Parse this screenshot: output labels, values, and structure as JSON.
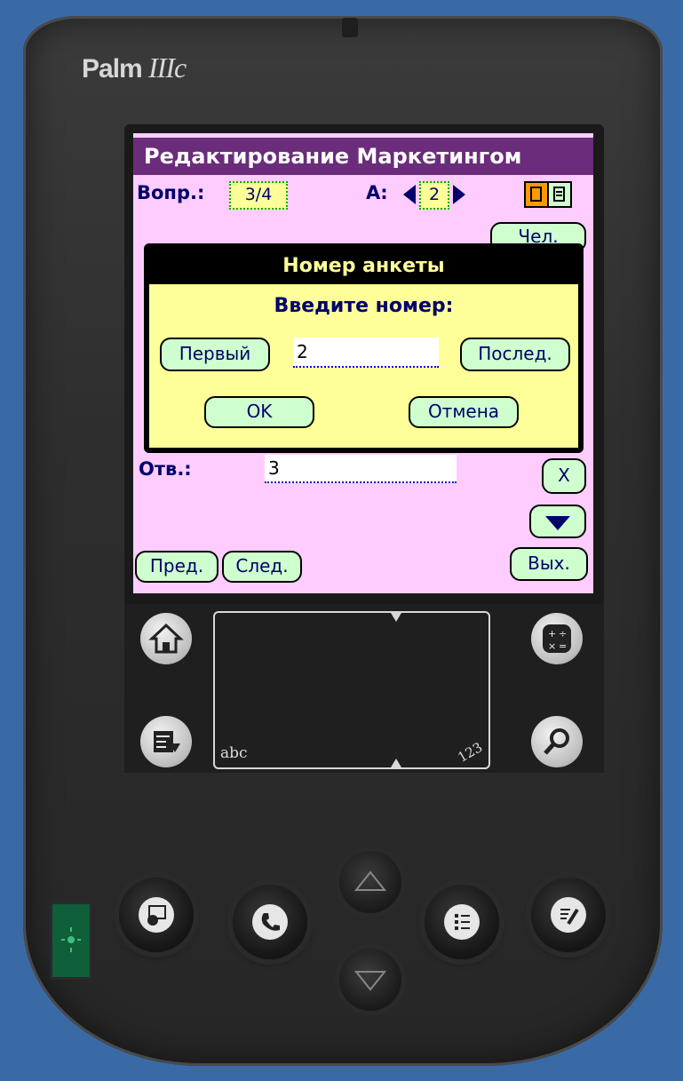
{
  "device": {
    "brand": "Palm IIIc",
    "brand_main": "Palm",
    "brand_model": "IIIc"
  },
  "app": {
    "title": "Редактирование Маркетингом",
    "question_label": "Вопр.:",
    "question_value": "3/4",
    "answer_set_label": "А:",
    "answer_set_value": "2",
    "hidden_button_label": "Чел.",
    "answer_label": "Отв.:",
    "answer_value": "3",
    "clear_button": "X",
    "prev_button": "Пред.",
    "next_button": "След.",
    "exit_button": "Вых."
  },
  "dialog": {
    "title": "Номер анкеты",
    "message": "Введите номер:",
    "first_button": "Первый",
    "number_value": "2",
    "last_button": "Послед.",
    "ok_button": "OK",
    "cancel_button": "Отмена"
  },
  "silkscreen": {
    "abc": "abc",
    "num": "123"
  },
  "colors": {
    "screen_bg": "#ffccff",
    "titlebar": "#6b2c7c",
    "dialog_bg": "#ffff99",
    "button_bg": "#cfffcf",
    "text": "#00006a"
  }
}
